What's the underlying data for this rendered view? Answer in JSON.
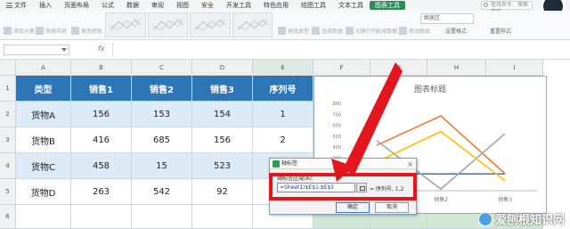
{
  "menubar": {
    "file": "文件",
    "items": [
      "插入",
      "页面布局",
      "公式",
      "数据",
      "审阅",
      "视图",
      "安全",
      "开发工具",
      "特色应用",
      "绘图工具",
      "文本工具",
      "图表工具"
    ],
    "active": "图表工具",
    "search_placeholder": "查找命令、搜索模板"
  },
  "toolbar": {
    "add_element": "添加元素",
    "quick_layout": "快速布局",
    "change_color": "更改颜色",
    "change_type": "更改类型",
    "select_data": "选择数据",
    "switch_row_col": "切换行列",
    "select_range": "选择数据",
    "move_chart": "移动图表",
    "chart_area": "图表区",
    "set_format": "设置格式",
    "reset_style": "重置样式"
  },
  "formula_bar": {
    "fx": "fx",
    "value": ""
  },
  "sheet": {
    "columns": [
      "A",
      "B",
      "C",
      "D",
      "E",
      "F",
      "G",
      "H",
      "I"
    ],
    "rows": [
      "1",
      "2",
      "3",
      "4",
      "5",
      "6"
    ],
    "header": [
      "类型",
      "销售1",
      "销售2",
      "销售3",
      "序列号"
    ],
    "data": [
      [
        "货物A",
        "156",
        "153",
        "154",
        "1"
      ],
      [
        "货物B",
        "416",
        "685",
        "156",
        "2"
      ],
      [
        "货物C",
        "458",
        "15",
        "523",
        "3"
      ],
      [
        "货物D",
        "263",
        "542",
        "92",
        ""
      ]
    ]
  },
  "chart": {
    "title": "图表标题",
    "y_ticks": [
      "800",
      "700",
      "600",
      "500",
      "400",
      "300",
      "200",
      "100",
      "0"
    ],
    "x_labels": [
      "销售2",
      "销售3"
    ],
    "colors": [
      "#4472c4",
      "#ed7d31",
      "#a5a5a5",
      "#ffc000"
    ]
  },
  "chart_data": {
    "type": "line",
    "title": "图表标题",
    "categories": [
      "销售1",
      "销售2",
      "销售3"
    ],
    "series": [
      {
        "name": "货物A",
        "values": [
          156,
          153,
          154
        ]
      },
      {
        "name": "货物B",
        "values": [
          416,
          685,
          156
        ]
      },
      {
        "name": "货物C",
        "values": [
          458,
          15,
          523
        ]
      },
      {
        "name": "货物D",
        "values": [
          263,
          542,
          92
        ]
      }
    ],
    "ylim": [
      0,
      800
    ],
    "xlabel": "",
    "ylabel": "",
    "grid": false
  },
  "dialog": {
    "title": "轴标签",
    "label": "轴标签区域(A):",
    "value": "=Sheet1!$E$1:$E$5",
    "preview": "= 序列号, 1,2",
    "ok": "确定",
    "cancel": "取消",
    "close": "×"
  },
  "watermark": "爱刨根知识网"
}
